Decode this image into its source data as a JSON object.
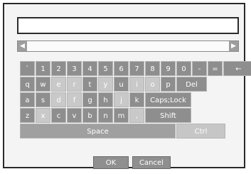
{
  "input": {
    "value": ""
  },
  "scrollbar": {
    "left_arrow": "◀",
    "right_arrow": "▶"
  },
  "keyboard": {
    "rows": [
      [
        "`",
        "1",
        "2",
        "3",
        "4",
        "5",
        "6",
        "7",
        "8",
        "9",
        "0",
        "-",
        "=",
        "←"
      ],
      [
        "q",
        "w",
        "e",
        "r",
        "t",
        "y",
        "u",
        "i",
        "o",
        "p",
        "Del"
      ],
      [
        "a",
        "s",
        "d",
        "f",
        "g",
        "h",
        "j",
        "k",
        "Caps;Lock"
      ],
      [
        "z",
        "x",
        "c",
        "v",
        "b",
        "n",
        "m",
        ",",
        "Shift"
      ],
      [
        "Space",
        "Ctrl"
      ]
    ]
  },
  "buttons": {
    "ok": "OK",
    "cancel": "Cancel"
  }
}
